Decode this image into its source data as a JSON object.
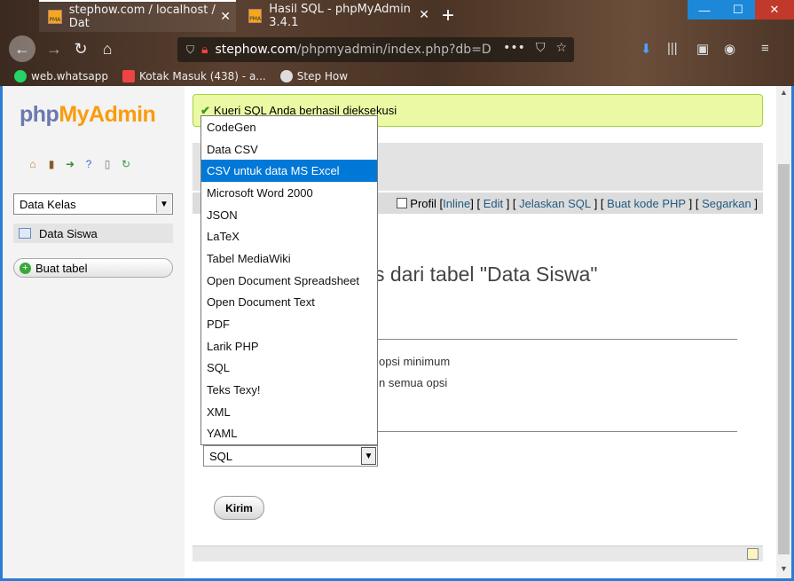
{
  "browser": {
    "tabs": [
      {
        "title": "stephow.com / localhost / Dat"
      },
      {
        "title": "Hasil SQL - phpMyAdmin 3.4.1"
      }
    ],
    "url_host": "stephow.com",
    "url_path": "/phpmyadmin/index.php?db=D",
    "bookmarks": [
      "web.whatsapp",
      "Kotak Masuk (438) - a...",
      "Step How"
    ]
  },
  "sidebar": {
    "logo": {
      "php": "php",
      "myadmin": "MyAdmin"
    },
    "db_select": "Data Kelas",
    "tables": [
      {
        "label": "Data Siswa"
      }
    ],
    "create_table": "Buat tabel"
  },
  "main": {
    "success_message": "Kueri SQL Anda berhasil dieksekusi",
    "sql_links": {
      "profil": "Profil",
      "inline": "Inline",
      "edit": "Edit",
      "explain": "Jelaskan SQL",
      "php_code": "Buat kode PHP",
      "refresh": "Segarkan"
    },
    "heading": "s dari tabel \"Data Siswa\"",
    "option_minimum": "opsi minimum",
    "option_all": "n semua opsi",
    "format_select": "SQL",
    "submit": "Kirim"
  },
  "dropdown": {
    "selected_index": 2,
    "options": [
      "CodeGen",
      "Data CSV",
      "CSV untuk data MS Excel",
      "Microsoft Word 2000",
      "JSON",
      "LaTeX",
      "Tabel MediaWiki",
      "Open Document Spreadsheet",
      "Open Document Text",
      "PDF",
      "Larik PHP",
      "SQL",
      "Teks Texy!",
      "XML",
      "YAML"
    ]
  },
  "colors": {
    "selection": "#0078d7",
    "success_bg": "#ebf8a4",
    "link": "#235a81"
  }
}
